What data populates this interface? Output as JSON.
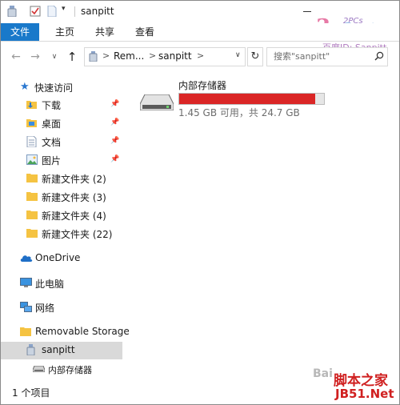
{
  "window": {
    "title": "sanpitt"
  },
  "ribbon": {
    "tabs": [
      {
        "label": "文件",
        "active": true
      },
      {
        "label": "主页"
      },
      {
        "label": "共享"
      },
      {
        "label": "查看"
      }
    ]
  },
  "address": {
    "crumbs": [
      "Rem...",
      "sanpitt"
    ],
    "separator": ">"
  },
  "search": {
    "placeholder": "搜索\"sanpitt\""
  },
  "nav": {
    "quick_access": "快速访问",
    "pinned": [
      {
        "label": "下载"
      },
      {
        "label": "桌面"
      },
      {
        "label": "文档"
      },
      {
        "label": "图片"
      }
    ],
    "folders": [
      {
        "label": "新建文件夹 (2)"
      },
      {
        "label": "新建文件夹 (3)"
      },
      {
        "label": "新建文件夹 (4)"
      },
      {
        "label": "新建文件夹 (22)"
      }
    ],
    "onedrive": "OneDrive",
    "this_pc": "此电脑",
    "network": "网络",
    "removable": "Removable Storage",
    "device": "sanpitt",
    "storage": "内部存储器"
  },
  "content": {
    "drive_name": "内部存储器",
    "used_fraction": 0.94,
    "free_text": "1.45 GB 可用，共 24.7 GB"
  },
  "status": {
    "items": "1 个项目"
  },
  "watermarks": {
    "top_big": "3",
    "top_small": "2PCs",
    "top_id": "百度ID: Sanpitt",
    "bottom_baidu": "Bai",
    "bottom_site": "脚本之家",
    "bottom_url": "JB51.Net"
  },
  "colors": {
    "accent": "#1979ca",
    "bar_fill": "#da2626",
    "bar_bg": "#e6e6e6",
    "selected_bg": "#d9d9d9",
    "folder": "#f5c342",
    "onedrive": "#1f6fc7"
  }
}
